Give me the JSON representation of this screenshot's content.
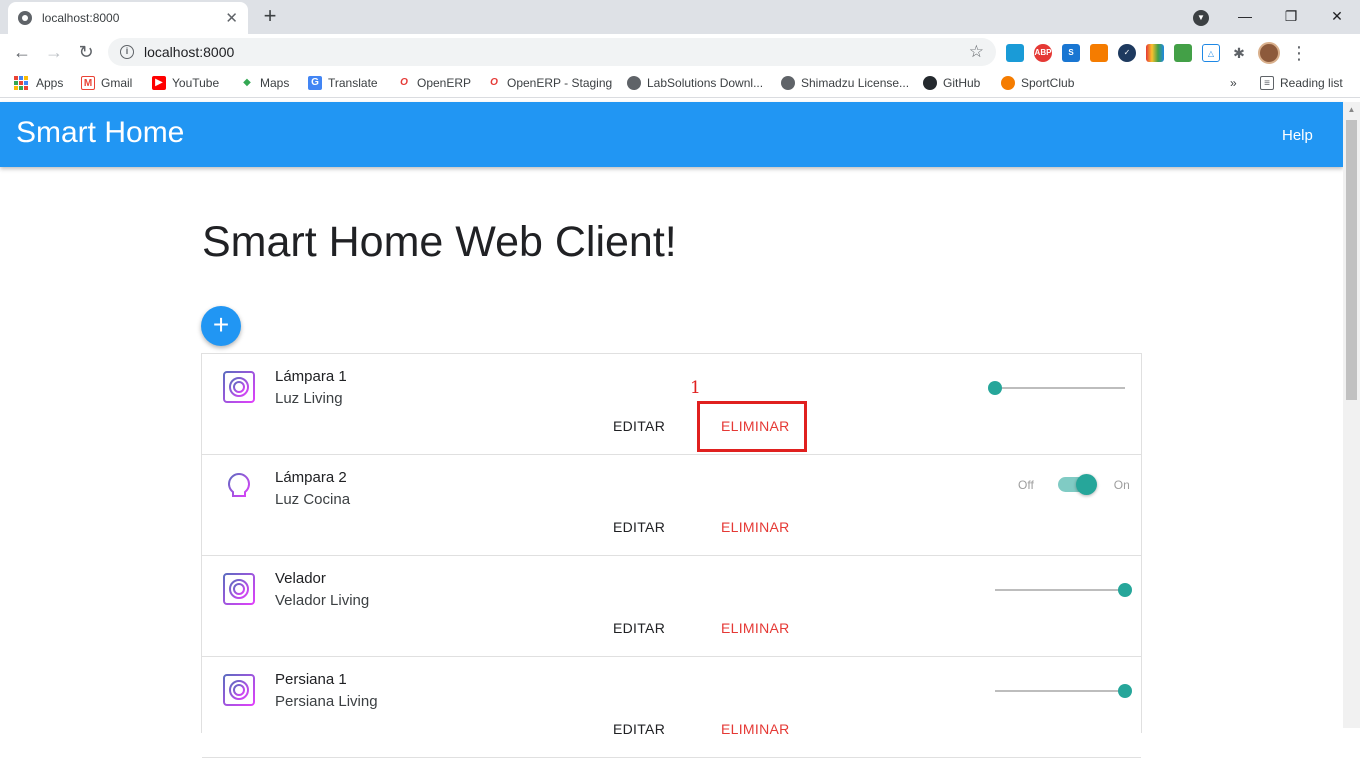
{
  "browser": {
    "tab_title": "localhost:8000",
    "url": "localhost:8000",
    "bookmarks": [
      {
        "label": "Apps",
        "icon": "apps-grid-icon"
      },
      {
        "label": "Gmail",
        "icon": "gmail-icon"
      },
      {
        "label": "YouTube",
        "icon": "youtube-icon"
      },
      {
        "label": "Maps",
        "icon": "maps-icon"
      },
      {
        "label": "Translate",
        "icon": "translate-icon"
      },
      {
        "label": "OpenERP",
        "icon": "openerp-icon"
      },
      {
        "label": "OpenERP - Staging",
        "icon": "openerp-icon"
      },
      {
        "label": "LabSolutions Downl...",
        "icon": "globe-icon"
      },
      {
        "label": "Shimadzu License...",
        "icon": "globe-icon"
      },
      {
        "label": "GitHub",
        "icon": "github-icon"
      },
      {
        "label": "SportClub",
        "icon": "sportclub-icon"
      }
    ],
    "more_bookmarks": "»",
    "reading_list": "Reading list"
  },
  "app": {
    "title": "Smart Home",
    "help_label": "Help",
    "heading": "Smart Home Web Client!",
    "add_label": "+",
    "edit_label": "EDITAR",
    "delete_label": "ELIMINAR",
    "accent_color": "#2196f3",
    "delete_color": "#e53935",
    "control_color": "#26a69a"
  },
  "devices": [
    {
      "name": "Lámpara 1",
      "location": "Luz Living",
      "icon": "dimmer-icon",
      "control": "slider",
      "level": 0
    },
    {
      "name": "Lámpara 2",
      "location": "Luz Cocina",
      "icon": "lightbulb-icon",
      "control": "switch",
      "off_label": "Off",
      "on_label": "On",
      "on": true
    },
    {
      "name": "Velador",
      "location": "Velador Living",
      "icon": "dimmer-icon",
      "control": "slider",
      "level": 1
    },
    {
      "name": "Persiana 1",
      "location": "Persiana Living",
      "icon": "dimmer-icon",
      "control": "slider",
      "level": 1
    }
  ],
  "annotation": {
    "label": "1",
    "color": "#e0201f"
  }
}
